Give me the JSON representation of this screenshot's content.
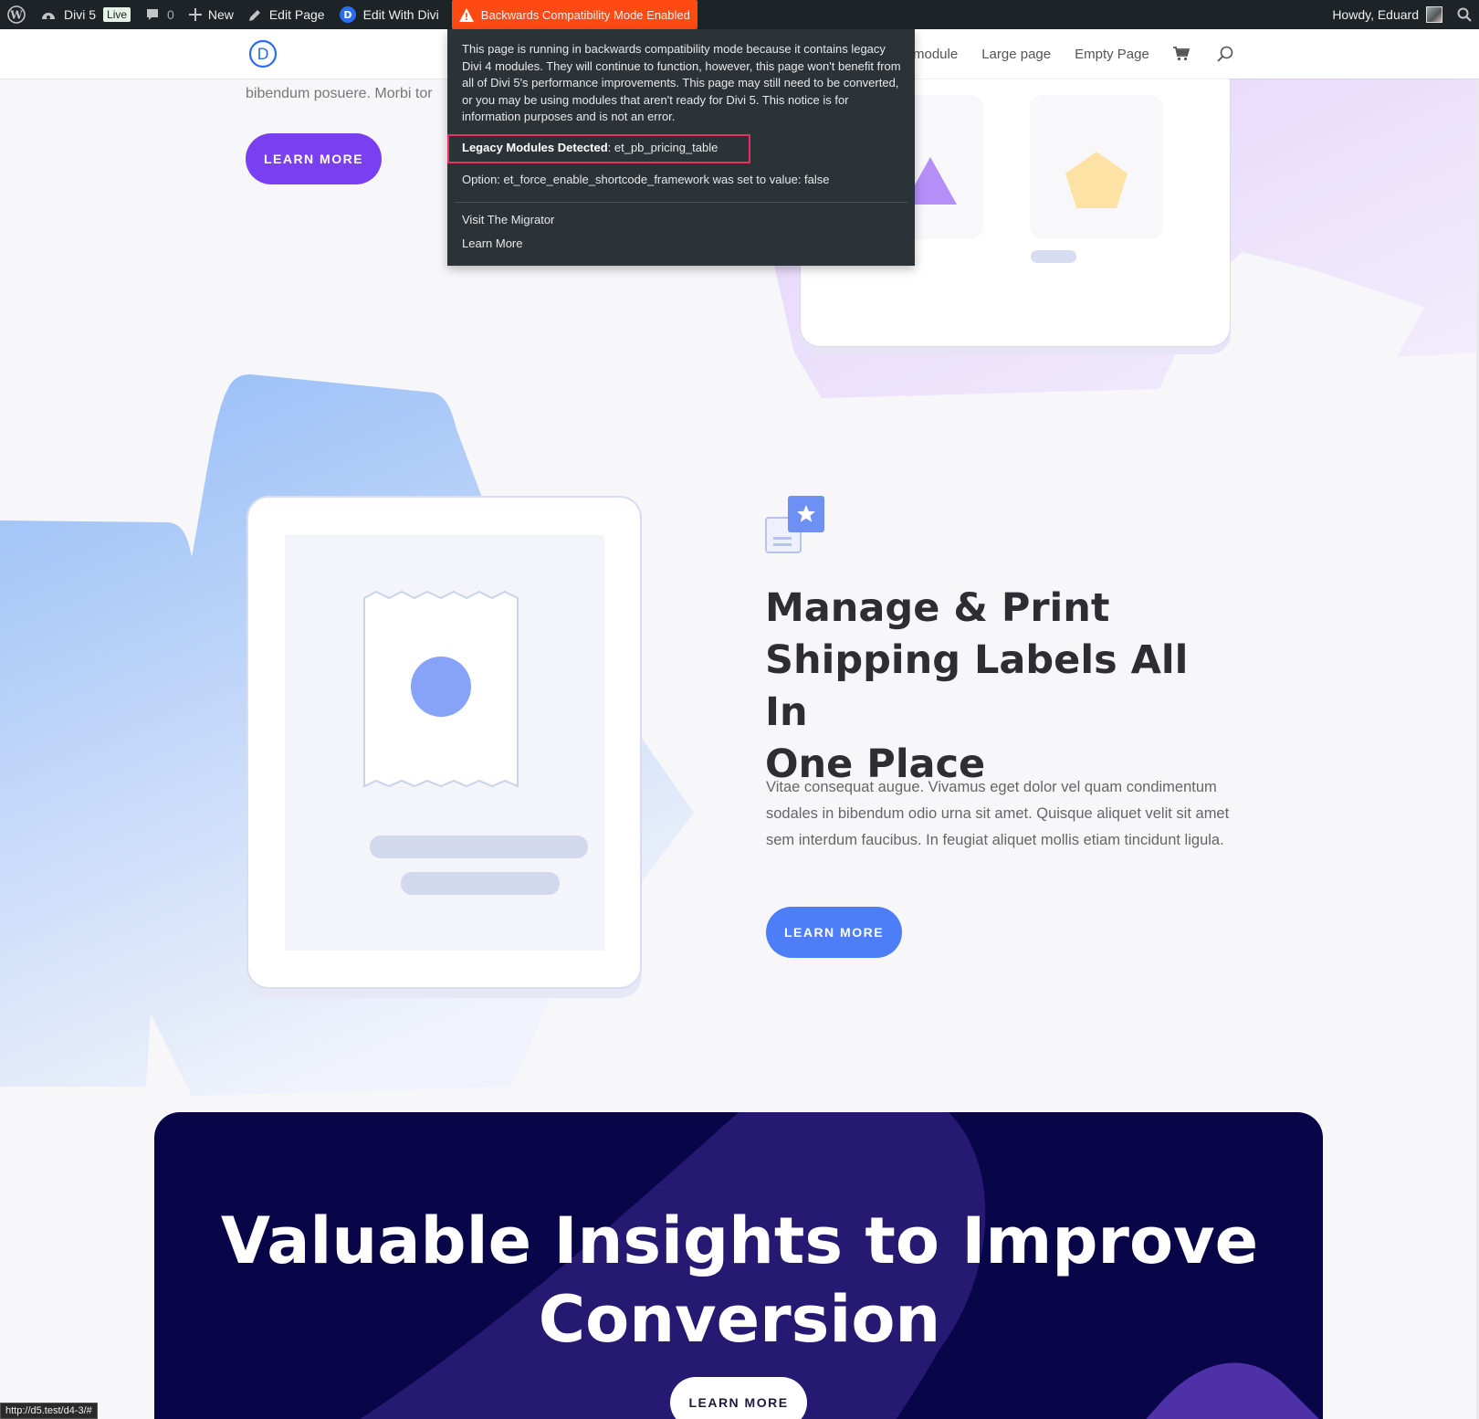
{
  "admin_bar": {
    "site_name": "Divi 5",
    "live_badge": "Live",
    "comments_count": "0",
    "new_label": "New",
    "edit_page_label": "Edit Page",
    "edit_with_divi_label": "Edit With Divi",
    "compat_label": "Backwards Compatibility Mode Enabled",
    "howdy": "Howdy, Eduard",
    "compat_color": "#ff4a14"
  },
  "compat_dropdown": {
    "notice": "This page is running in backwards compatibility mode because it contains legacy Divi 4 modules. They will continue to function, however, this page won't benefit from all of Divi 5's performance improvements. This page may still need to be converted, or you may be using modules that aren't ready for Divi 5. This notice is for information purposes and is not an error.",
    "legacy_label": "Legacy Modules Detected",
    "legacy_value": ": et_pb_pricing_table",
    "option_line": "Option: et_force_enable_shortcode_framework was set to value: false",
    "links": [
      "Visit The Migrator",
      "Learn More"
    ]
  },
  "site_header": {
    "logo_letter": "D",
    "nav": [
      "module",
      "Large page",
      "Empty Page"
    ],
    "icons": [
      "cart-icon",
      "search-icon"
    ]
  },
  "upper_section": {
    "paragraph_fragment": "bibendum posuere. Morbi tor",
    "button": "LEARN MORE",
    "button_color": "#7b3ff2"
  },
  "feature": {
    "heading_lines": [
      "Manage & Print",
      "Shipping Labels All In",
      "One Place"
    ],
    "body": "Vitae consequat augue. Vivamus eget dolor vel quam condimentum sodales in bibendum odio urna sit amet. Quisque aliquet velit sit amet sem interdum faucibus. In feugiat aliquet mollis etiam tincidunt ligula.",
    "button": "LEARN MORE",
    "button_color": "#4d7ef7"
  },
  "cta": {
    "title_lines": [
      "Valuable Insights to Improve",
      "Conversion"
    ],
    "button": "LEARN MORE",
    "background": "#080548"
  },
  "status_url": "http://d5.test/d4-3/#"
}
